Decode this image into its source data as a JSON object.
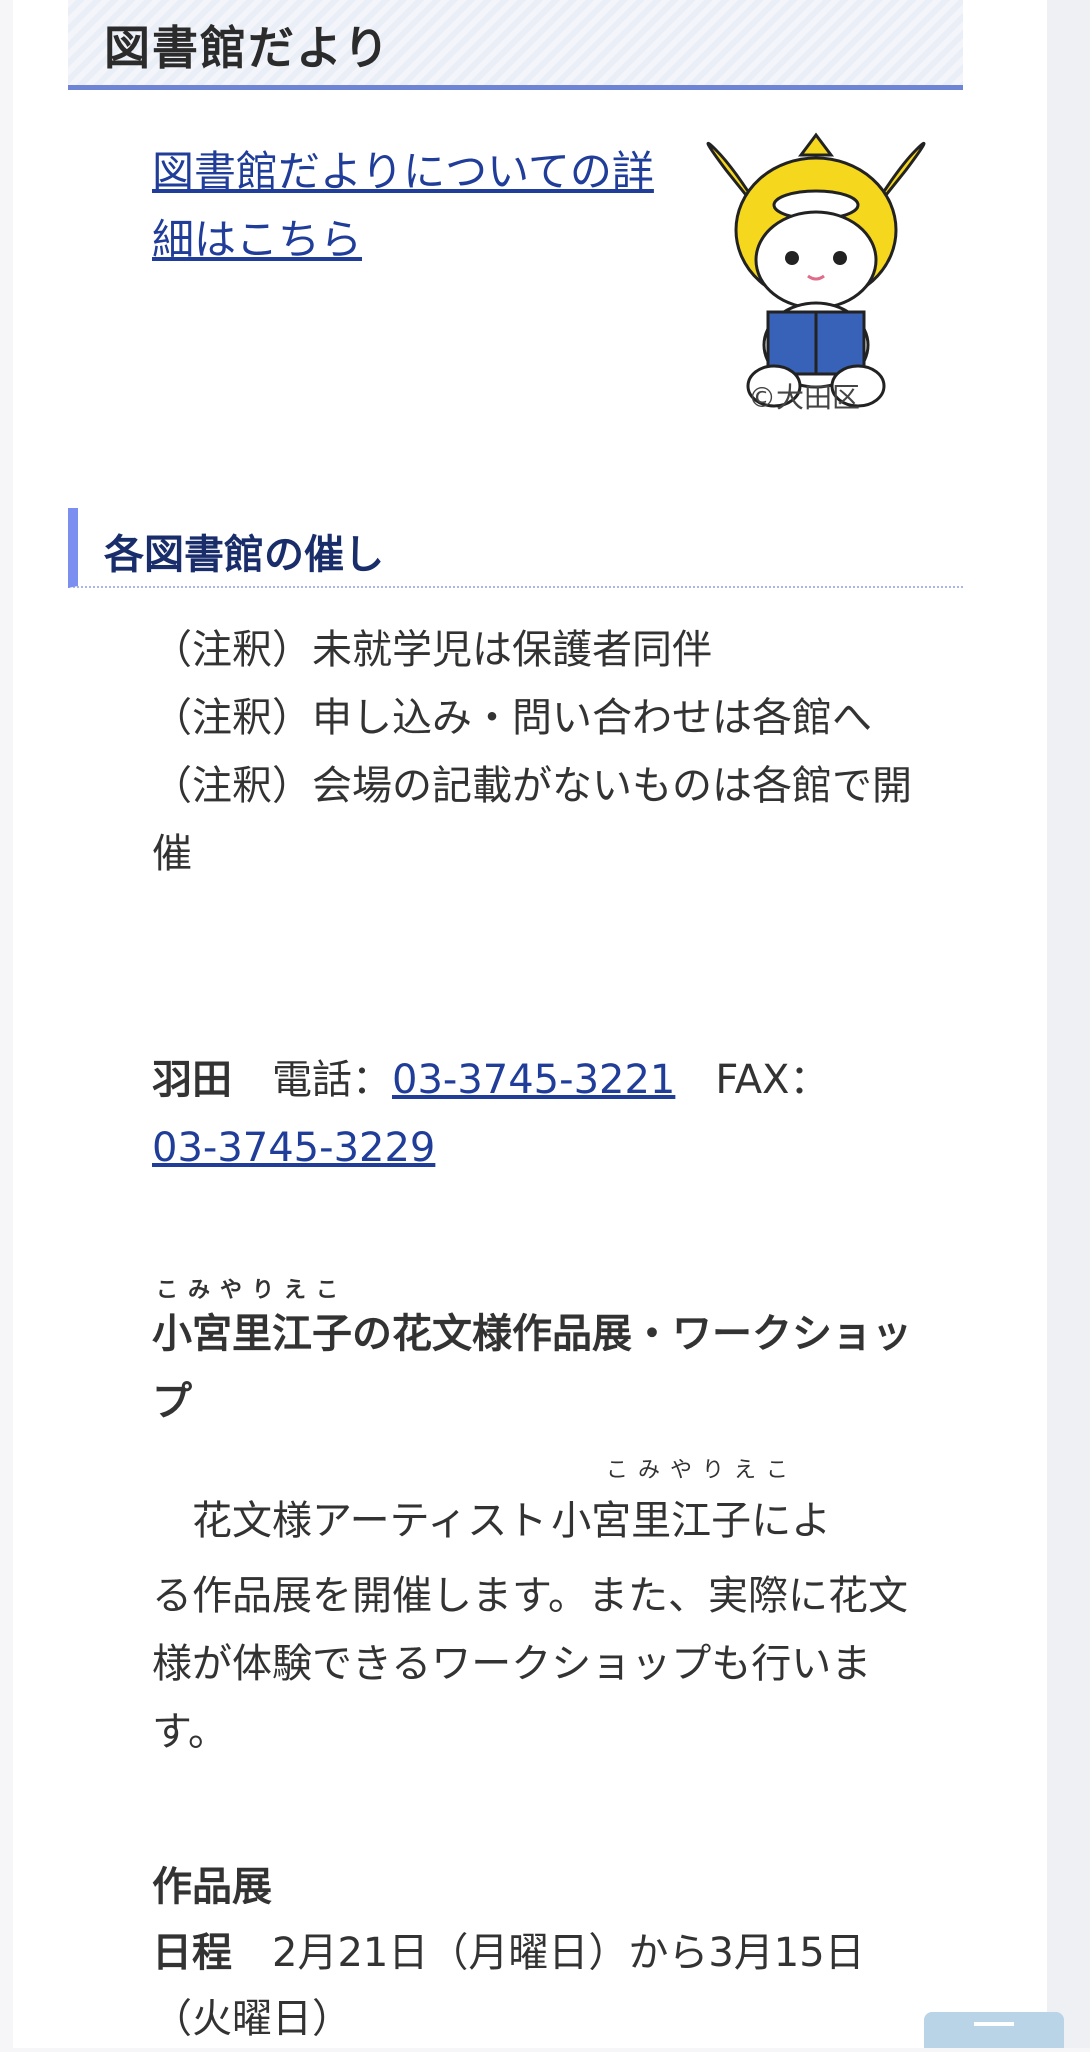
{
  "heading_main": "図書館だより",
  "intro_link": "図書館だよりについての詳細はこちら",
  "mascot": {
    "icon": "mascot-character-reading",
    "copyright": "©大田区"
  },
  "heading_events": "各図書館の催し",
  "notes": [
    "（注釈）未就学児は保護者同伴",
    "（注釈）申し込み・問い合わせは各館へ",
    "（注釈）会場の記載がないものは各館で開催"
  ],
  "contact": {
    "branch": "羽田",
    "phone_label": "電話：",
    "phone": "03-3745-3221",
    "fax_label": "FAX：",
    "fax": "03-3745-3229"
  },
  "event": {
    "title_ruby": "こみやりえこ",
    "title": "小宮里江子の花文様作品展・ワークショップ",
    "desc_prefix": "花文様アーティスト",
    "desc_name": "小宮里江子",
    "desc_name_ruby": "こみやりえこ",
    "desc_suffix": "によ",
    "desc_rest": "る作品展を開催します。また、実際に花文様が体験できるワークショップも行います。"
  },
  "exhibition": {
    "label": "作品展",
    "schedule_label": "日程",
    "schedule_value": "2月21日（月曜日）から3月15日（火曜日）"
  },
  "colors": {
    "link": "#1f3d99",
    "accent": "#6e85d6",
    "heading_events": "#1a2d6b"
  }
}
